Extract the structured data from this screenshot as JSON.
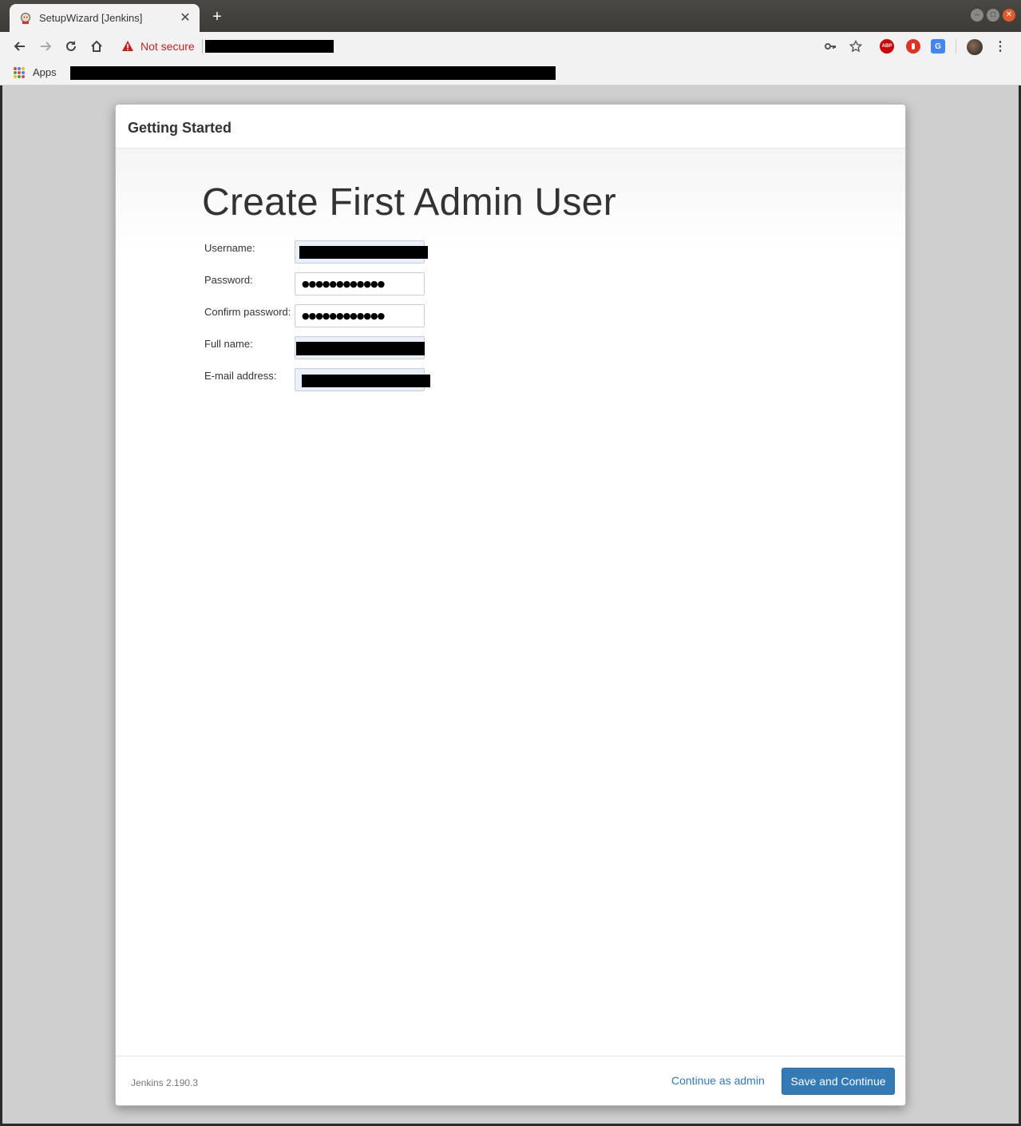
{
  "browser": {
    "tab_title": "SetupWizard [Jenkins]",
    "security_label": "Not secure",
    "bookmarks_apps_label": "Apps"
  },
  "icons": [
    "jenkins-favicon",
    "back-icon",
    "forward-icon",
    "reload-icon",
    "home-icon",
    "warning-icon",
    "key-icon",
    "star-icon",
    "adblock-icon",
    "extension-icon",
    "translate-icon",
    "avatar",
    "menu-icon",
    "apps-grid-icon"
  ],
  "colors": {
    "accent": "#337ab7",
    "warning": "#c5221f"
  },
  "wizard": {
    "header_title": "Getting Started",
    "heading": "Create First Admin User",
    "fields": {
      "username_label": "Username:",
      "password_label": "Password:",
      "password_value": "●●●●●●●●●●●●",
      "confirm_label": "Confirm password:",
      "confirm_value": "●●●●●●●●●●●●",
      "fullname_label": "Full name:",
      "email_label": "E-mail address:"
    },
    "footer": {
      "version": "Jenkins 2.190.3",
      "continue_admin": "Continue as admin",
      "save_continue": "Save and Continue"
    }
  }
}
